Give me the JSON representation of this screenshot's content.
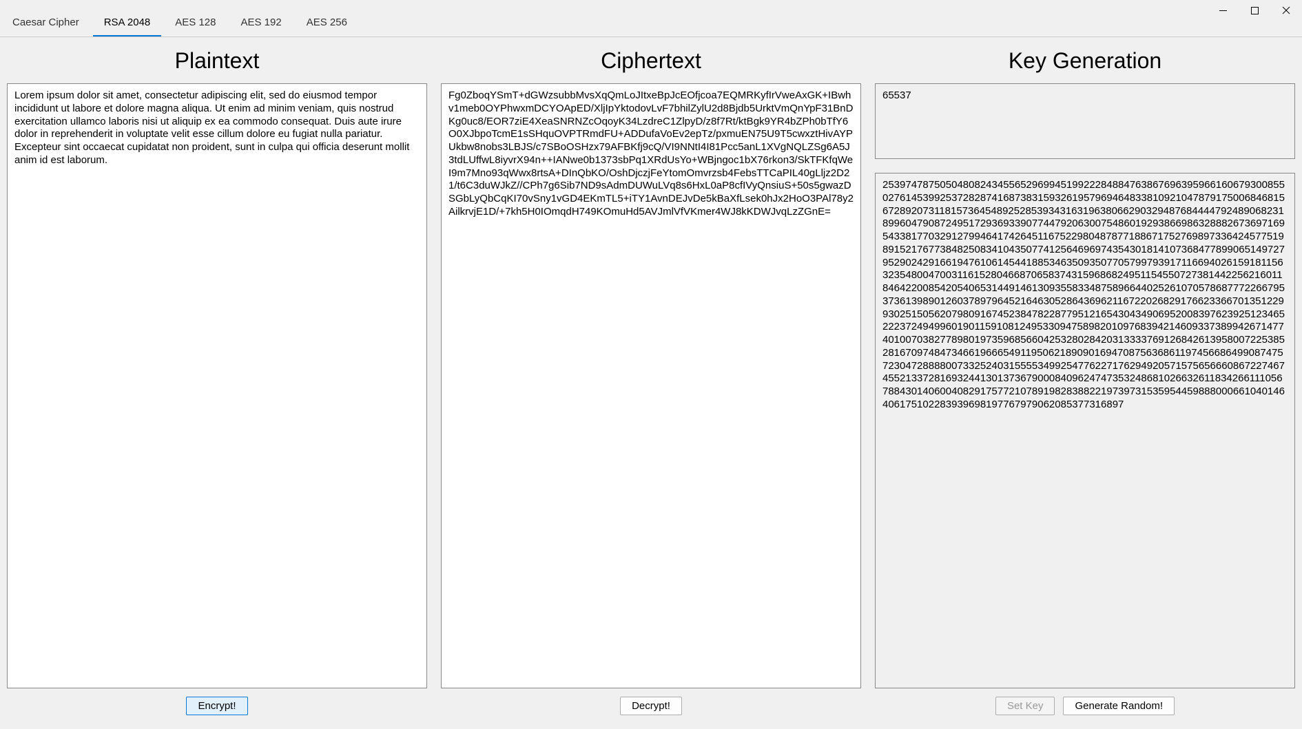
{
  "tabs": [
    {
      "label": "Caesar Cipher",
      "active": false
    },
    {
      "label": "RSA 2048",
      "active": true
    },
    {
      "label": "AES 128",
      "active": false
    },
    {
      "label": "AES 192",
      "active": false
    },
    {
      "label": "AES 256",
      "active": false
    }
  ],
  "headings": {
    "plaintext": "Plaintext",
    "ciphertext": "Ciphertext",
    "keygen": "Key Generation"
  },
  "plaintext": "Lorem ipsum dolor sit amet, consectetur adipiscing elit, sed do eiusmod tempor incididunt ut labore et dolore magna aliqua. Ut enim ad minim veniam, quis nostrud exercitation ullamco laboris nisi ut aliquip ex ea commodo consequat. Duis aute irure dolor in reprehenderit in voluptate velit esse cillum dolore eu fugiat nulla pariatur. Excepteur sint occaecat cupidatat non proident, sunt in culpa qui officia deserunt mollit anim id est laborum.",
  "ciphertext": "Fg0ZboqYSmT+dGWzsubbMvsXqQmLoJItxeBpJcEOfjcoa7EQMRKyfIrVweAxGK+IBwhv1meb0OYPhwxmDCYOApED/XljIpYktodovLvF7bhilZylU2d8Bjdb5UrktVmQnYpF31BnDKg0uc8/EOR7ziE4XeaSNRNZcOqoyK34LzdreC1ZlpyD/z8f7Rt/ktBgk9YR4bZPh0bTfY6O0XJbpoTcmE1sSHquOVPTRmdFU+ADDufaVoEv2epTz/pxmuEN75U9T5cwxztHivAYPUkbw8nobs3LBJS/c7SBoOSHzx79AFBKfj9cQ/VI9NNtI4I81Pcc5anL1XVgNQLZSg6A5J3tdLUffwL8iyvrX94n++IANwe0b1373sbPq1XRdUsYo+WBjngoc1bX76rkon3/SkTFKfqWeI9m7Mno93qWwx8rtsA+DInQbKO/OshDjczjFeYtomOmvrzsb4FebsTTCaPIL40gLljz2D21/t6C3duWJkZ//CPh7g6Sib7ND9sAdmDUWuLVq8s6HxL0aP8cfIVyQnsiuS+50s5gwazDSGbLyQbCqKI70vSny1vGD4EKmTL5+iTY1AvnDEJvDe5kBaXfLsek0hJx2HoO3PAl78y2AilkrvjE1D/+7kh5H0IOmqdH749KOmuHd5AVJmlVfVKmer4WJ8kKDWJvqLzZGnE=",
  "public_exponent": "65537",
  "modulus": "25397478750504808243455652969945199222848847638676963959661606793008550276145399253728287416873831593261957969464833810921047879175006846815672892073118157364548925285393431631963806629032948768444479248906823189960479087249517293693390774479206300754860192938669863288826736971695433817703291279946417426451167522980487877188671752769897336424577519891521767738482508341043507741256469697435430181410736847789906514972795290242916619476106145441885346350935077057997939171166940261591811563235480047003116152804668706583743159686824951154550727381442256216011846422008542054065314491461309355833487589664402526107057868777226679537361398901260378979645216463052864369621167220268291766233667013512299302515056207980916745238478228779512165430434906952008397623925123465222372494996019011591081249533094758982010976839421460933738994267147740100703827789801973596856604253280284203133337691268426139580072253852816709748473466196665491195062189090169470875636861197456686499087475723047288880073325240315555349925477622717629492057157565666086722746745521337281693244130137367900084096247473532486810266326118342661110567884301406004082917577210789198283882219739731535954459888000661040146406175102283939698197767979062085377316897",
  "buttons": {
    "encrypt": "Encrypt!",
    "decrypt": "Decrypt!",
    "set_key": "Set Key",
    "generate_random": "Generate Random!"
  }
}
